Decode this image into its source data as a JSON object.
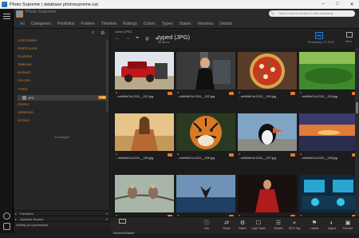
{
  "window": {
    "title": "Photo Supreme | database photosupreme.cat",
    "buttons": [
      "–",
      "□",
      "✕"
    ]
  },
  "header": {
    "app_name": "Photo Supreme",
    "subtitle": "",
    "tabs": [
      {
        "label": "All",
        "active": true
      },
      {
        "label": "Categories",
        "active": false
      },
      {
        "label": "Portfolios",
        "active": false
      },
      {
        "label": "Folders",
        "active": false
      },
      {
        "label": "Timeline",
        "active": false
      },
      {
        "label": "Ratings",
        "active": false
      },
      {
        "label": "Colors",
        "active": false
      },
      {
        "label": "Types",
        "active": false
      },
      {
        "label": "States",
        "active": false
      },
      {
        "label": "Versions",
        "active": false
      },
      {
        "label": "Details",
        "active": false
      }
    ],
    "search_placeholder": "Type a word or phrase to start searching"
  },
  "sidebar": {
    "items": [
      {
        "label": "CATEGORIES"
      },
      {
        "label": "PORTFOLIOS"
      },
      {
        "label": "FOLDERS"
      },
      {
        "label": "TIMELINE"
      },
      {
        "label": "RATINGS"
      },
      {
        "label": "COLORS"
      },
      {
        "label": "TYPES"
      }
    ],
    "jpg_item": {
      "label": "JPG",
      "count": "1.8k"
    },
    "items_after": [
      {
        "label": "STATES"
      },
      {
        "label": "VERSIONS"
      },
      {
        "label": "DETAILS"
      }
    ],
    "all_images_label": "All Images",
    "panels": [
      {
        "label": "Favorites"
      },
      {
        "label": "Dynamic Search"
      },
      {
        "label": "Activity (no processes)"
      }
    ]
  },
  "content": {
    "crumb": "Label (JPG)",
    "title": "typed (JPG)",
    "subtitle": "All items",
    "ps_badge": "Ps",
    "ps_name": "Photoshop CC 2019",
    "view_label": "View"
  },
  "thumbnails": [
    {
      "name": "...edWithCel-2131__021.jpg",
      "scene": "car"
    },
    {
      "name": "...edWithCel-2131__022.jpg",
      "scene": "portrait"
    },
    {
      "name": "...edWithCel-2131__023.jpg",
      "scene": "pizza"
    },
    {
      "name": "...edWithCel-2131__024.jpg",
      "scene": "grass"
    },
    {
      "name": "...edWithCel-2131__025.jpg",
      "scene": "girl"
    },
    {
      "name": "...edWithCel-2131__026.jpg",
      "scene": "tiger"
    },
    {
      "name": "...edWithCel-2131__027.jpg",
      "scene": "puffin"
    },
    {
      "name": "...edWithCel-2131__028.jpg",
      "scene": "sunset"
    },
    {
      "name": "",
      "scene": "birds"
    },
    {
      "name": "",
      "scene": "whale"
    },
    {
      "name": "",
      "scene": "woman-red"
    },
    {
      "name": "",
      "scene": "cockpit"
    }
  ],
  "toolbar": [
    {
      "label": "Shoebox/Basket",
      "icon": "box-icon"
    },
    {
      "label": "Info",
      "icon": "info-icon",
      "glyph": "ⓘ"
    },
    {
      "label": "Share",
      "icon": "share-icon",
      "glyph": "⇄"
    },
    {
      "label": "Batch",
      "icon": "batch-icon",
      "glyph": "⚙"
    },
    {
      "label": "Light Table",
      "icon": "lighttable-icon",
      "glyph": "☐"
    },
    {
      "label": "Details",
      "icon": "details-icon",
      "glyph": "☰"
    },
    {
      "label": "GEO Tag",
      "icon": "geotag-icon",
      "glyph": "⌖"
    },
    {
      "label": "Labels",
      "icon": "labels-icon",
      "glyph": "⚑"
    },
    {
      "label": "Adjust",
      "icon": "adjust-icon",
      "glyph": "◐"
    },
    {
      "label": "Preview",
      "icon": "preview-icon",
      "glyph": "▣"
    }
  ],
  "colors": {
    "accent": "#3fa0e6",
    "orange": "#e08a2a"
  }
}
